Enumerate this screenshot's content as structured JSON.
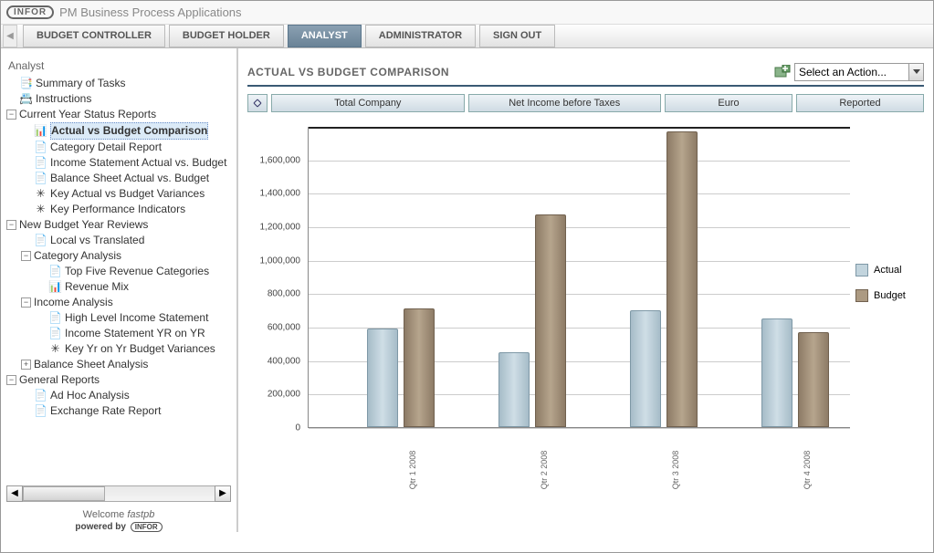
{
  "header": {
    "logo_text": "INFOR",
    "app_title": "PM Business Process Applications"
  },
  "tabs": [
    {
      "label": "BUDGET CONTROLLER"
    },
    {
      "label": "BUDGET HOLDER"
    },
    {
      "label": "ANALYST",
      "active": true
    },
    {
      "label": "ADMINISTRATOR"
    },
    {
      "label": "SIGN OUT"
    }
  ],
  "sidebar": {
    "section_title": "Analyst",
    "welcome_prefix": "Welcome ",
    "welcome_user": "fastpb",
    "powered_prefix": "powered by ",
    "powered_logo": "INFOR",
    "tree": {
      "summary": "Summary of Tasks",
      "instructions": "Instructions",
      "cysr": {
        "label": "Current Year Status Reports",
        "children": {
          "avb": "Actual vs Budget Comparison",
          "cdr": "Category Detail Report",
          "isavb": "Income Statement Actual vs. Budget",
          "bsavb": "Balance Sheet Actual vs. Budget",
          "kavbv": "Key Actual vs Budget Variances",
          "kpi": "Key Performance Indicators"
        }
      },
      "nbyr": {
        "label": "New Budget Year Reviews",
        "children": {
          "lvt": "Local vs Translated",
          "ca": {
            "label": "Category Analysis",
            "children": {
              "tfrc": "Top Five Revenue Categories",
              "rm": "Revenue Mix"
            }
          },
          "ia": {
            "label": "Income Analysis",
            "children": {
              "hlis": "High Level Income Statement",
              "isyy": "Income Statement YR on YR",
              "kyybv": "Key Yr on Yr Budget Variances"
            }
          },
          "bsa": {
            "label": "Balance Sheet Analysis"
          }
        }
      },
      "gr": {
        "label": "General Reports",
        "children": {
          "adhoc": "Ad Hoc Analysis",
          "err": "Exchange Rate Report"
        }
      }
    }
  },
  "content": {
    "title": "ACTUAL VS BUDGET COMPARISON",
    "action_select": "Select an Action...",
    "filters": {
      "f1": "Total Company",
      "f2": "Net Income before Taxes",
      "f3": "Euro",
      "f4": "Reported"
    },
    "legend": {
      "actual": "Actual",
      "budget": "Budget"
    }
  },
  "chart_data": {
    "type": "bar",
    "categories": [
      "Qtr 1 2008",
      "Qtr 2 2008",
      "Qtr 3 2008",
      "Qtr 4 2008"
    ],
    "series": [
      {
        "name": "Actual",
        "values": [
          590000,
          450000,
          700000,
          650000
        ]
      },
      {
        "name": "Budget",
        "values": [
          710000,
          1270000,
          1770000,
          570000
        ]
      }
    ],
    "ylim": [
      0,
      1800000
    ],
    "yticks": [
      0,
      200000,
      400000,
      600000,
      800000,
      1000000,
      1200000,
      1400000,
      1600000
    ],
    "title": "",
    "xlabel": "",
    "ylabel": ""
  }
}
